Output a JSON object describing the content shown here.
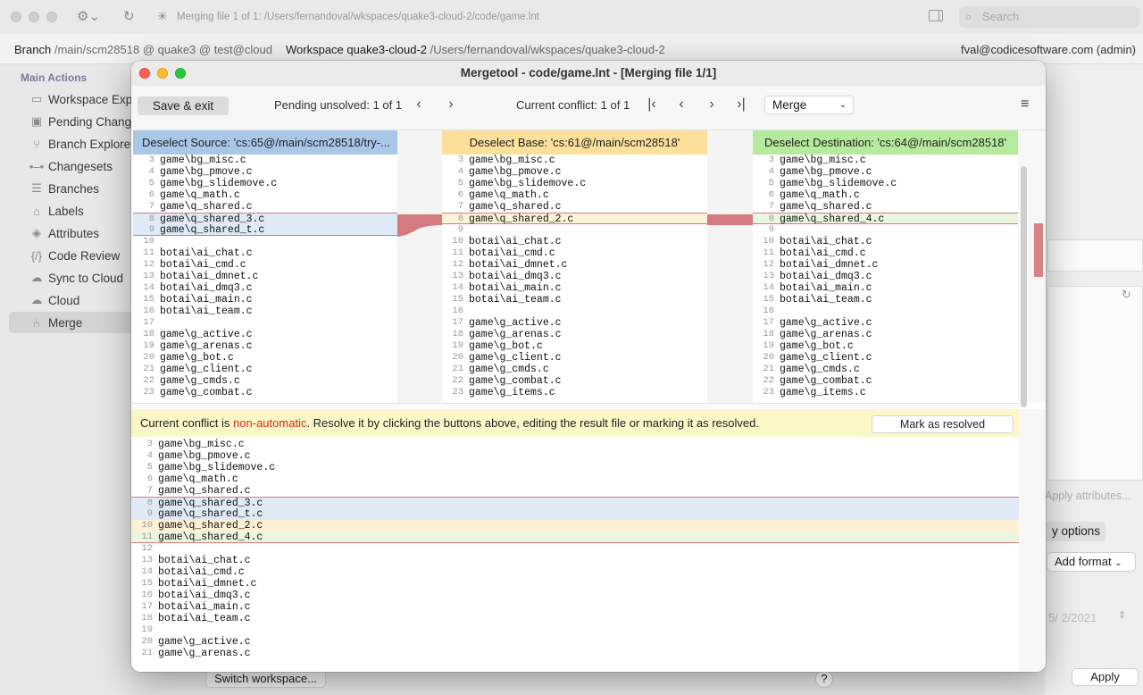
{
  "app": {
    "status": "Merging file 1 of 1: /Users/fernandoval/wkspaces/quake3-cloud-2/code/game.lnt",
    "search_placeholder": "Search",
    "branch_label": "Branch",
    "branch_value": "/main/scm28518 @ quake3 @ test@cloud",
    "workspace_label": "Workspace",
    "workspace_name": "quake3-cloud-2",
    "workspace_path": "/Users/fernandoval/wkspaces/quake3-cloud-2",
    "user": "fval@codicesoftware.com (admin)"
  },
  "sidebar": {
    "header": "Main Actions",
    "items": [
      {
        "label": "Workspace Exp",
        "icon": "folder-icon"
      },
      {
        "label": "Pending Chang",
        "icon": "pending-changes-icon"
      },
      {
        "label": "Branch Explore",
        "icon": "branch-icon"
      },
      {
        "label": "Changesets",
        "icon": "changeset-icon"
      },
      {
        "label": "Branches",
        "icon": "list-icon"
      },
      {
        "label": "Labels",
        "icon": "tag-icon"
      },
      {
        "label": "Attributes",
        "icon": "attribute-tag-icon"
      },
      {
        "label": "Code Review",
        "icon": "code-icon"
      },
      {
        "label": "Sync to Cloud",
        "icon": "cloud-sync-icon"
      },
      {
        "label": "Cloud",
        "icon": "cloud-icon"
      },
      {
        "label": "Merge",
        "icon": "merge-icon"
      }
    ]
  },
  "background_right": {
    "apply_attributes": "Apply attributes...",
    "options": "y options",
    "add_format": "Add format",
    "date": "5/  2/2021",
    "apply": "Apply",
    "switch_workspace": "Switch workspace...",
    "help": "?"
  },
  "window": {
    "title": "Mergetool - code/game.lnt - [Merging file 1/1]",
    "save_exit": "Save & exit",
    "pending": "Pending unsolved: 1 of 1",
    "current_conflict": "Current conflict: 1 of 1",
    "mode": "Merge"
  },
  "panes": {
    "source": {
      "header": "Deselect Source: 'cs:65@/main/scm28518/try-...",
      "lines": [
        {
          "n": "3",
          "t": "game\\bg_misc.c"
        },
        {
          "n": "4",
          "t": "game\\bg_pmove.c"
        },
        {
          "n": "5",
          "t": "game\\bg_slidemove.c"
        },
        {
          "n": "6",
          "t": "game\\q_math.c"
        },
        {
          "n": "7",
          "t": "game\\q_shared.c"
        },
        {
          "n": "8",
          "t": "game\\q_shared_3.c",
          "hl": "blue"
        },
        {
          "n": "9",
          "t": "game\\q_shared_t.c",
          "hl": "blue"
        },
        {
          "n": "10",
          "t": ""
        },
        {
          "n": "11",
          "t": "botai\\ai_chat.c"
        },
        {
          "n": "12",
          "t": "botai\\ai_cmd.c"
        },
        {
          "n": "13",
          "t": "botai\\ai_dmnet.c"
        },
        {
          "n": "14",
          "t": "botai\\ai_dmq3.c"
        },
        {
          "n": "15",
          "t": "botai\\ai_main.c"
        },
        {
          "n": "16",
          "t": "botai\\ai_team.c"
        },
        {
          "n": "17",
          "t": ""
        },
        {
          "n": "18",
          "t": "game\\g_active.c"
        },
        {
          "n": "19",
          "t": "game\\g_arenas.c"
        },
        {
          "n": "20",
          "t": "game\\g_bot.c"
        },
        {
          "n": "21",
          "t": "game\\g_client.c"
        },
        {
          "n": "22",
          "t": "game\\g_cmds.c"
        },
        {
          "n": "23",
          "t": "game\\g_combat.c"
        }
      ]
    },
    "base": {
      "header": "Deselect Base: 'cs:61@/main/scm28518'",
      "lines": [
        {
          "n": "3",
          "t": "game\\bg_misc.c"
        },
        {
          "n": "4",
          "t": "game\\bg_pmove.c"
        },
        {
          "n": "5",
          "t": "game\\bg_slidemove.c"
        },
        {
          "n": "6",
          "t": "game\\q_math.c"
        },
        {
          "n": "7",
          "t": "game\\q_shared.c"
        },
        {
          "n": "8",
          "t": "game\\q_shared_2.c",
          "hl": "yellow"
        },
        {
          "n": "9",
          "t": ""
        },
        {
          "n": "10",
          "t": "botai\\ai_chat.c"
        },
        {
          "n": "11",
          "t": "botai\\ai_cmd.c"
        },
        {
          "n": "12",
          "t": "botai\\ai_dmnet.c"
        },
        {
          "n": "13",
          "t": "botai\\ai_dmq3.c"
        },
        {
          "n": "14",
          "t": "botai\\ai_main.c"
        },
        {
          "n": "15",
          "t": "botai\\ai_team.c"
        },
        {
          "n": "16",
          "t": ""
        },
        {
          "n": "17",
          "t": "game\\g_active.c"
        },
        {
          "n": "18",
          "t": "game\\g_arenas.c"
        },
        {
          "n": "19",
          "t": "game\\g_bot.c"
        },
        {
          "n": "20",
          "t": "game\\g_client.c"
        },
        {
          "n": "21",
          "t": "game\\g_cmds.c"
        },
        {
          "n": "22",
          "t": "game\\g_combat.c"
        },
        {
          "n": "23",
          "t": "game\\g_items.c"
        }
      ]
    },
    "destination": {
      "header": "Deselect Destination: 'cs:64@/main/scm28518'",
      "lines": [
        {
          "n": "3",
          "t": "game\\bg_misc.c"
        },
        {
          "n": "4",
          "t": "game\\bg_pmove.c"
        },
        {
          "n": "5",
          "t": "game\\bg_slidemove.c"
        },
        {
          "n": "6",
          "t": "game\\q_math.c"
        },
        {
          "n": "7",
          "t": "game\\q_shared.c"
        },
        {
          "n": "8",
          "t": "game\\q_shared_4.c",
          "hl": "green"
        },
        {
          "n": "9",
          "t": ""
        },
        {
          "n": "10",
          "t": "botai\\ai_chat.c"
        },
        {
          "n": "11",
          "t": "botai\\ai_cmd.c"
        },
        {
          "n": "12",
          "t": "botai\\ai_dmnet.c"
        },
        {
          "n": "13",
          "t": "botai\\ai_dmq3.c"
        },
        {
          "n": "14",
          "t": "botai\\ai_main.c"
        },
        {
          "n": "15",
          "t": "botai\\ai_team.c"
        },
        {
          "n": "16",
          "t": ""
        },
        {
          "n": "17",
          "t": "game\\g_active.c"
        },
        {
          "n": "18",
          "t": "game\\g_arenas.c"
        },
        {
          "n": "19",
          "t": "game\\g_bot.c"
        },
        {
          "n": "20",
          "t": "game\\g_client.c"
        },
        {
          "n": "21",
          "t": "game\\g_cmds.c"
        },
        {
          "n": "22",
          "t": "game\\g_combat.c"
        },
        {
          "n": "23",
          "t": "game\\g_items.c"
        }
      ]
    }
  },
  "conflict": {
    "prefix": "Current conflict is ",
    "type": "non-automatic",
    "suffix": ". Resolve it by clicking the buttons above, editing the result file or marking it as resolved.",
    "mark_resolved": "Mark as resolved"
  },
  "result": {
    "lines": [
      {
        "n": "3",
        "t": "game\\bg_misc.c"
      },
      {
        "n": "4",
        "t": "game\\bg_pmove.c"
      },
      {
        "n": "5",
        "t": "game\\bg_slidemove.c"
      },
      {
        "n": "6",
        "t": "game\\q_math.c"
      },
      {
        "n": "7",
        "t": "game\\q_shared.c"
      },
      {
        "n": "8",
        "t": "game\\q_shared_3.c",
        "hl": "blue"
      },
      {
        "n": "9",
        "t": "game\\q_shared_t.c",
        "hl": "blue"
      },
      {
        "n": "10",
        "t": "game\\q_shared_2.c",
        "hl": "orange"
      },
      {
        "n": "11",
        "t": "game\\q_shared_4.c",
        "hl": "green"
      },
      {
        "n": "12",
        "t": ""
      },
      {
        "n": "13",
        "t": "botai\\ai_chat.c"
      },
      {
        "n": "14",
        "t": "botai\\ai_cmd.c"
      },
      {
        "n": "15",
        "t": "botai\\ai_dmnet.c"
      },
      {
        "n": "16",
        "t": "botai\\ai_dmq3.c"
      },
      {
        "n": "17",
        "t": "botai\\ai_main.c"
      },
      {
        "n": "18",
        "t": "botai\\ai_team.c"
      },
      {
        "n": "19",
        "t": ""
      },
      {
        "n": "20",
        "t": "game\\g_active.c"
      },
      {
        "n": "21",
        "t": "game\\g_arenas.c"
      }
    ]
  },
  "colors": {
    "source_header": "#a9c8e8",
    "base_header": "#fbdf9a",
    "destination_header": "#b6ea9c",
    "conflict_link": "#d57a7e",
    "accent_red": "#d82b1f"
  }
}
